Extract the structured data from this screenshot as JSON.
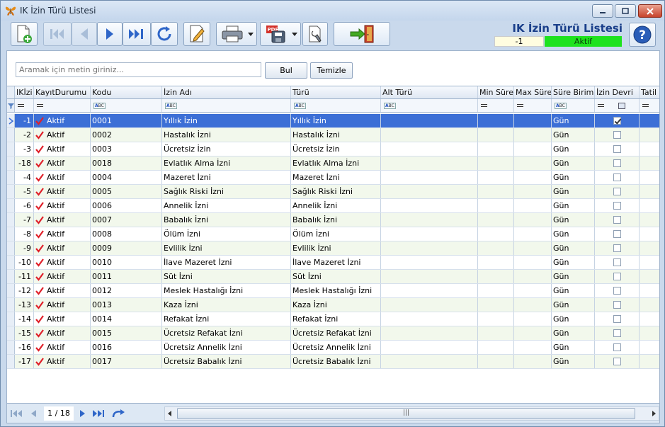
{
  "window": {
    "title": "IK İzin Türü Listesi"
  },
  "header": {
    "title": "IK İzin Türü Listesi",
    "record_id": "-1",
    "status": "Aktif",
    "status_color": "#1ee21e",
    "accent_color": "#1a3f8a"
  },
  "toolbar": {
    "buttons": [
      "new-record-icon",
      "first-record-icon",
      "previous-record-icon",
      "next-record-icon",
      "last-record-icon",
      "refresh-icon",
      "edit-icon",
      "print-icon",
      "export-pdf-icon",
      "settings-icon",
      "exit-icon"
    ]
  },
  "search": {
    "placeholder": "Aramak için metin giriniz...",
    "find_label": "Bul",
    "clear_label": "Temizle"
  },
  "grid": {
    "columns": [
      "IKİzinTürüID",
      "KayıtDurumu",
      "Kodu",
      "İzin Adı",
      "Türü",
      "Alt Türü",
      "Min Süre",
      "Max Süre",
      "Süre Birimi",
      "İzin Devri",
      "Tatil Dahil"
    ],
    "column_display": [
      "IKİzi",
      "KayıtDurumu",
      "Kodu",
      "İzin Adı",
      "Türü",
      "Alt Türü",
      "Min Süre",
      "Max Süre",
      "Süre Birimi",
      "İzin Devri",
      "Tatil D"
    ],
    "selected_row_color": "#3c6fd6",
    "rows": [
      {
        "id": "-1",
        "status": "Aktif",
        "code": "0001",
        "name": "Yıllık İzin",
        "type": "Yıllık İzin",
        "unit": "Gün",
        "devir": true,
        "tatil": true
      },
      {
        "id": "-2",
        "status": "Aktif",
        "code": "0002",
        "name": "Hastalık İzni",
        "type": "Hastalık İzni",
        "unit": "Gün",
        "devir": false,
        "tatil": true
      },
      {
        "id": "-3",
        "status": "Aktif",
        "code": "0003",
        "name": "Ücretsiz İzin",
        "type": "Ücretsiz İzin",
        "unit": "Gün",
        "devir": false,
        "tatil": true
      },
      {
        "id": "-18",
        "status": "Aktif",
        "code": "0018",
        "name": "Evlatlık Alma İzni",
        "type": "Evlatlık Alma İzni",
        "unit": "Gün",
        "devir": false,
        "tatil": true
      },
      {
        "id": "-4",
        "status": "Aktif",
        "code": "0004",
        "name": "Mazeret İzni",
        "type": "Mazeret İzni",
        "unit": "Gün",
        "devir": false,
        "tatil": true
      },
      {
        "id": "-5",
        "status": "Aktif",
        "code": "0005",
        "name": "Sağlık Riski İzni",
        "type": "Sağlık Riski İzni",
        "unit": "Gün",
        "devir": false,
        "tatil": true
      },
      {
        "id": "-6",
        "status": "Aktif",
        "code": "0006",
        "name": "Annelik İzni",
        "type": "Annelik İzni",
        "unit": "Gün",
        "devir": false,
        "tatil": true
      },
      {
        "id": "-7",
        "status": "Aktif",
        "code": "0007",
        "name": "Babalık İzni",
        "type": "Babalık İzni",
        "unit": "Gün",
        "devir": false,
        "tatil": true
      },
      {
        "id": "-8",
        "status": "Aktif",
        "code": "0008",
        "name": "Ölüm İzni",
        "type": "Ölüm İzni",
        "unit": "Gün",
        "devir": false,
        "tatil": true
      },
      {
        "id": "-9",
        "status": "Aktif",
        "code": "0009",
        "name": "Evlilik İzni",
        "type": "Evlilik İzni",
        "unit": "Gün",
        "devir": false,
        "tatil": true
      },
      {
        "id": "-10",
        "status": "Aktif",
        "code": "0010",
        "name": "İlave Mazeret İzni",
        "type": "İlave Mazeret İzni",
        "unit": "Gün",
        "devir": false,
        "tatil": true
      },
      {
        "id": "-11",
        "status": "Aktif",
        "code": "0011",
        "name": "Süt İzni",
        "type": "Süt İzni",
        "unit": "Gün",
        "devir": false,
        "tatil": true
      },
      {
        "id": "-12",
        "status": "Aktif",
        "code": "0012",
        "name": "Meslek Hastalığı İzni",
        "type": "Meslek Hastalığı İzni",
        "unit": "Gün",
        "devir": false,
        "tatil": true
      },
      {
        "id": "-13",
        "status": "Aktif",
        "code": "0013",
        "name": "Kaza İzni",
        "type": "Kaza İzni",
        "unit": "Gün",
        "devir": false,
        "tatil": true
      },
      {
        "id": "-14",
        "status": "Aktif",
        "code": "0014",
        "name": "Refakat İzni",
        "type": "Refakat İzni",
        "unit": "Gün",
        "devir": false,
        "tatil": true
      },
      {
        "id": "-15",
        "status": "Aktif",
        "code": "0015",
        "name": "Ücretsiz Refakat İzni",
        "type": "Ücretsiz Refakat İzni",
        "unit": "Gün",
        "devir": false,
        "tatil": true
      },
      {
        "id": "-16",
        "status": "Aktif",
        "code": "0016",
        "name": "Ücretsiz Annelik İzni",
        "type": "Ücretsiz Annelik İzni",
        "unit": "Gün",
        "devir": false,
        "tatil": true
      },
      {
        "id": "-17",
        "status": "Aktif",
        "code": "0017",
        "name": "Ücretsiz Babalık İzni",
        "type": "Ücretsiz Babalık İzni",
        "unit": "Gün",
        "devir": false,
        "tatil": true
      }
    ]
  },
  "footer": {
    "page_info": "1 / 18"
  }
}
